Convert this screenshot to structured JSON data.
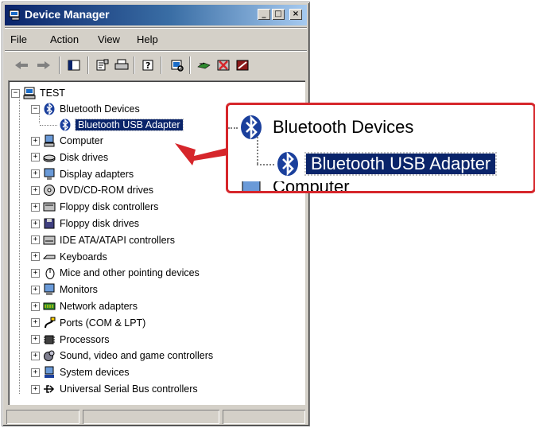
{
  "window": {
    "title": "Device Manager"
  },
  "title_buttons": {
    "minimize": "_",
    "maximize": "□",
    "close": "×"
  },
  "menu": [
    "File",
    "Action",
    "View",
    "Help"
  ],
  "toolbar_icons": [
    "back-arrow-icon",
    "forward-arrow-icon",
    "console-tree-icon",
    "properties-icon",
    "print-icon",
    "help-icon",
    "scan-hardware-icon",
    "update-driver-icon",
    "uninstall-icon",
    "disable-icon"
  ],
  "tree": {
    "root": "TEST",
    "bluetooth": {
      "label": "Bluetooth Devices",
      "child": "Bluetooth USB Adapter"
    },
    "categories": [
      "Computer",
      "Disk drives",
      "Display adapters",
      "DVD/CD-ROM drives",
      "Floppy disk controllers",
      "Floppy disk drives",
      "IDE ATA/ATAPI controllers",
      "Keyboards",
      "Mice and other pointing devices",
      "Monitors",
      "Network adapters",
      "Ports (COM & LPT)",
      "Processors",
      "Sound, video and game controllers",
      "System devices",
      "Universal Serial Bus controllers"
    ],
    "expander_collapsed": "+",
    "expander_expanded": "−"
  },
  "zoom_callout": {
    "category": "Bluetooth Devices",
    "selected": "Bluetooth USB Adapter",
    "partial": "Computer",
    "accent_color": "#d6262b"
  },
  "colors": {
    "selection": "#0a246a",
    "face": "#d4d0c8",
    "callout_border": "#d6262b"
  }
}
